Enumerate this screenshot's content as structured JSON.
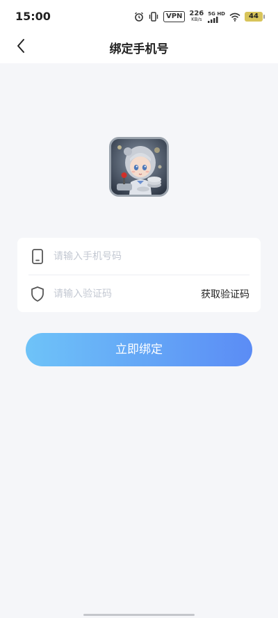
{
  "status_bar": {
    "time": "15:00",
    "vpn": "VPN",
    "speed_value": "226",
    "speed_unit": "KB/s",
    "network": "5G HD",
    "battery": "44",
    "icons": [
      "alarm-icon",
      "vibrate-icon",
      "signal-icon",
      "wifi-icon",
      "battery-icon"
    ]
  },
  "header": {
    "title": "绑定手机号",
    "back_icon": "chevron-left-icon"
  },
  "form": {
    "phone_placeholder": "请输入手机号码",
    "phone_value": "",
    "phone_icon": "phone-icon",
    "code_placeholder": "请输入验证码",
    "code_value": "",
    "code_icon": "shield-icon",
    "get_code_label": "获取验证码"
  },
  "submit_label": "立即绑定",
  "colors": {
    "background": "#f5f6f9",
    "button_start": "#6ec3f8",
    "button_end": "#5b8cf5"
  }
}
